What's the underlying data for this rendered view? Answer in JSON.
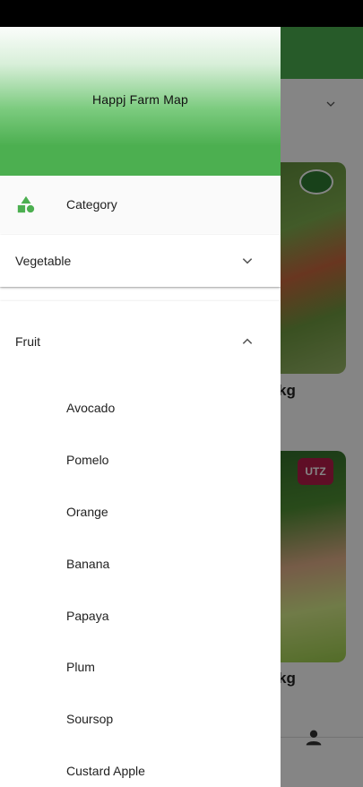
{
  "drawer": {
    "title": "Happj Farm Map",
    "category": {
      "label": "Category",
      "icon": "category-shapes-icon"
    },
    "panels": [
      {
        "label": "Vegetable",
        "expanded": false,
        "icon": "chevron-down-icon"
      },
      {
        "label": "Fruit",
        "expanded": true,
        "icon": "chevron-up-icon",
        "items": [
          "Avocado",
          "Pomelo",
          "Orange",
          "Banana",
          "Papaya",
          "Plum",
          "Soursop",
          "Custard Apple"
        ]
      }
    ]
  },
  "background": {
    "product_1_price_suffix": "kg",
    "product_2_price_suffix": "kg",
    "badge_2_text": "UTZ"
  },
  "colors": {
    "primary": "#4caf50",
    "icon_green": "#4caf50"
  }
}
